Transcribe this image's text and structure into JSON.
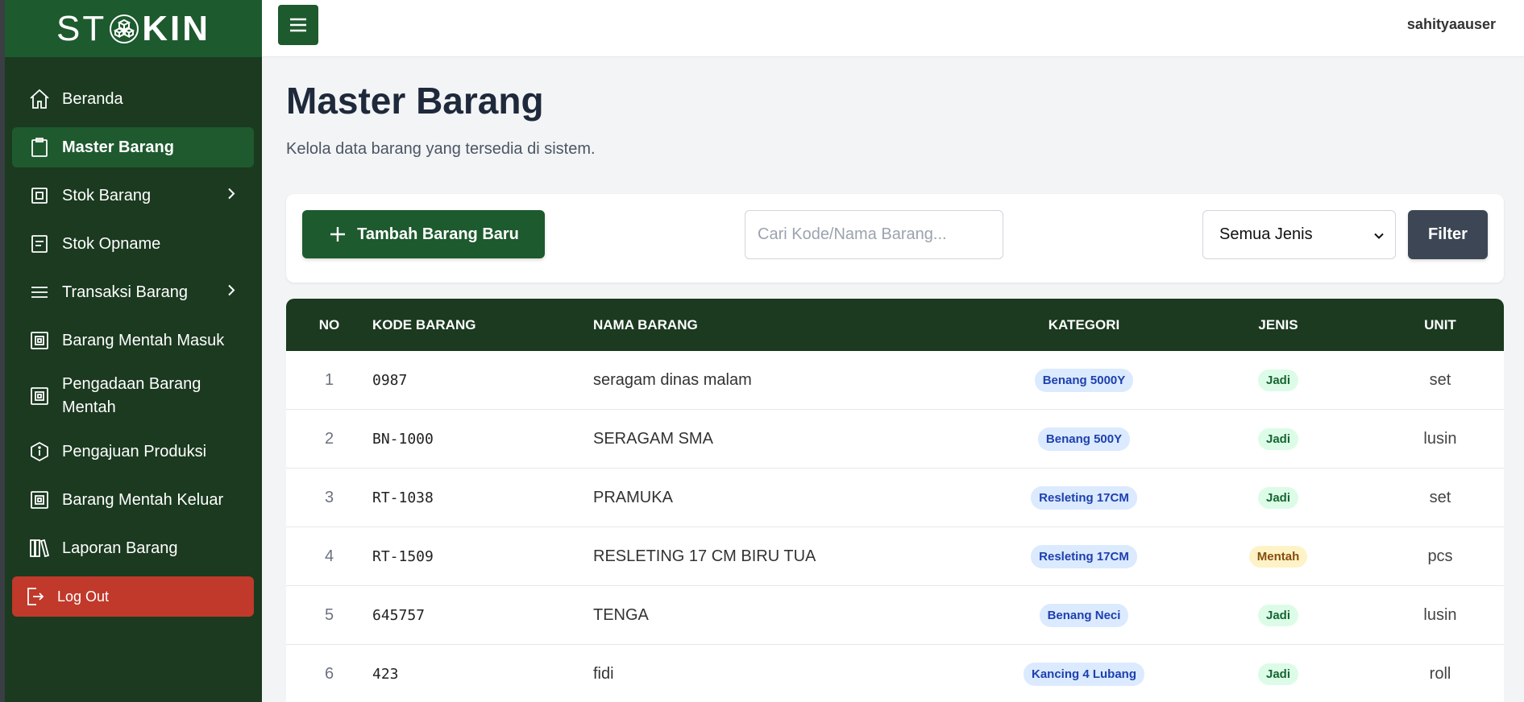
{
  "app": {
    "logo_left": "ST",
    "logo_right": "KIN",
    "username": "sahityaauser"
  },
  "sidebar": {
    "items": [
      {
        "label": "Beranda",
        "icon": "home-icon"
      },
      {
        "label": "Master Barang",
        "icon": "clipboard-icon",
        "active": true
      },
      {
        "label": "Stok Barang",
        "icon": "box-icon",
        "has_submenu": true
      },
      {
        "label": "Stok Opname",
        "icon": "document-icon"
      },
      {
        "label": "Transaksi Barang",
        "icon": "menu-lines-icon",
        "has_submenu": true
      },
      {
        "label": "Barang Mentah Masuk",
        "icon": "box-inbox-icon"
      },
      {
        "label": "Pengadaan Barang Mentah",
        "icon": "box-inbox-icon"
      },
      {
        "label": "Pengajuan Produksi",
        "icon": "hexagon-info-icon"
      },
      {
        "label": "Barang Mentah Keluar",
        "icon": "box-inbox-icon"
      },
      {
        "label": "Laporan Barang",
        "icon": "books-icon"
      }
    ],
    "logout_label": "Log Out"
  },
  "main": {
    "title": "Master Barang",
    "subtitle": "Kelola data barang yang tersedia di sistem.",
    "add_button_label": "Tambah Barang Baru",
    "search_placeholder": "Cari Kode/Nama Barang...",
    "jenis_select_value": "Semua Jenis",
    "filter_button_label": "Filter"
  },
  "table": {
    "headers": {
      "no": "NO",
      "kode": "KODE BARANG",
      "nama": "NAMA BARANG",
      "kategori": "KATEGORI",
      "jenis": "JENIS",
      "unit": "UNIT"
    },
    "rows": [
      {
        "no": "1",
        "kode": "0987",
        "nama": "seragam dinas malam",
        "kategori": "Benang 5000Y",
        "jenis": "Jadi",
        "unit": "set"
      },
      {
        "no": "2",
        "kode": "BN-1000",
        "nama": "SERAGAM SMA",
        "kategori": "Benang 500Y",
        "jenis": "Jadi",
        "unit": "lusin"
      },
      {
        "no": "3",
        "kode": "RT-1038",
        "nama": "PRAMUKA",
        "kategori": "Resleting 17CM",
        "jenis": "Jadi",
        "unit": "set"
      },
      {
        "no": "4",
        "kode": "RT-1509",
        "nama": "RESLETING 17 CM BIRU TUA",
        "kategori": "Resleting 17CM",
        "jenis": "Mentah",
        "unit": "pcs"
      },
      {
        "no": "5",
        "kode": "645757",
        "nama": "TENGA",
        "kategori": "Benang Neci",
        "jenis": "Jadi",
        "unit": "lusin"
      },
      {
        "no": "6",
        "kode": "423",
        "nama": "fidi",
        "kategori": "Kancing 4 Lubang",
        "jenis": "Jadi",
        "unit": "roll"
      }
    ]
  },
  "colors": {
    "sidebar_bg": "#1b3a20",
    "brand_green": "#1d5a2e",
    "logout_red": "#c0392b",
    "filter_btn": "#3d4654"
  }
}
